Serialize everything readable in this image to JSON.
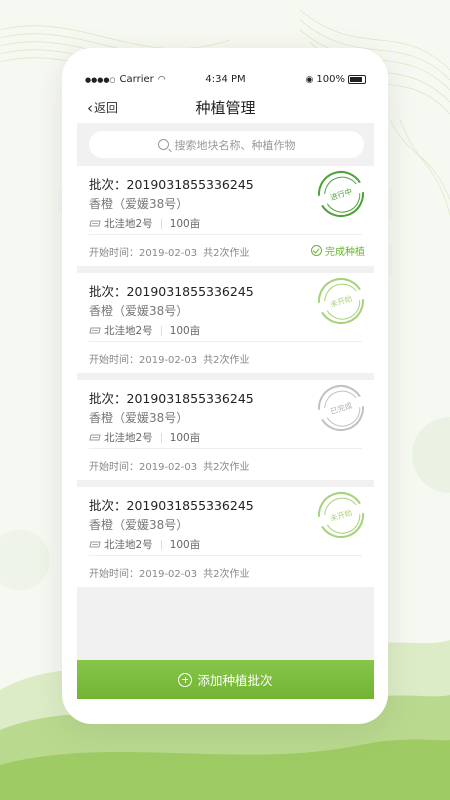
{
  "status_bar": {
    "carrier": "Carrier",
    "time": "4:34 PM",
    "battery": "100%"
  },
  "nav": {
    "back_label": "返回",
    "title": "种植管理"
  },
  "search": {
    "placeholder": "搜索地块名称、种植作物"
  },
  "cards": [
    {
      "batch": "批次：2019031855336245",
      "crop": "香橙（爱媛38号）",
      "plot": "北洼地2号",
      "area": "100亩",
      "start": "开始时间：2019-02-03",
      "jobs": "共2次作业",
      "stamp": "进行中",
      "action": "完成种植"
    },
    {
      "batch": "批次：2019031855336245",
      "crop": "香橙（爱媛38号）",
      "plot": "北洼地2号",
      "area": "100亩",
      "start": "开始时间：2019-02-03",
      "jobs": "共2次作业",
      "stamp": "未开始"
    },
    {
      "batch": "批次：2019031855336245",
      "crop": "香橙（爱媛38号）",
      "plot": "北洼地2号",
      "area": "100亩",
      "start": "开始时间：2019-02-03",
      "jobs": "共2次作业",
      "stamp": "已完成"
    },
    {
      "batch": "批次：2019031855336245",
      "crop": "香橙（爱媛38号）",
      "plot": "北洼地2号",
      "area": "100亩",
      "start": "开始时间：2019-02-03",
      "jobs": "共2次作业",
      "stamp": "未开始"
    }
  ],
  "add_button": {
    "label": "添加种植批次"
  },
  "colors": {
    "accent": "#7aba3a",
    "stamp_active": "#4fa23a",
    "stamp_pending": "#a7d27a",
    "stamp_done": "#c2c2c2"
  }
}
